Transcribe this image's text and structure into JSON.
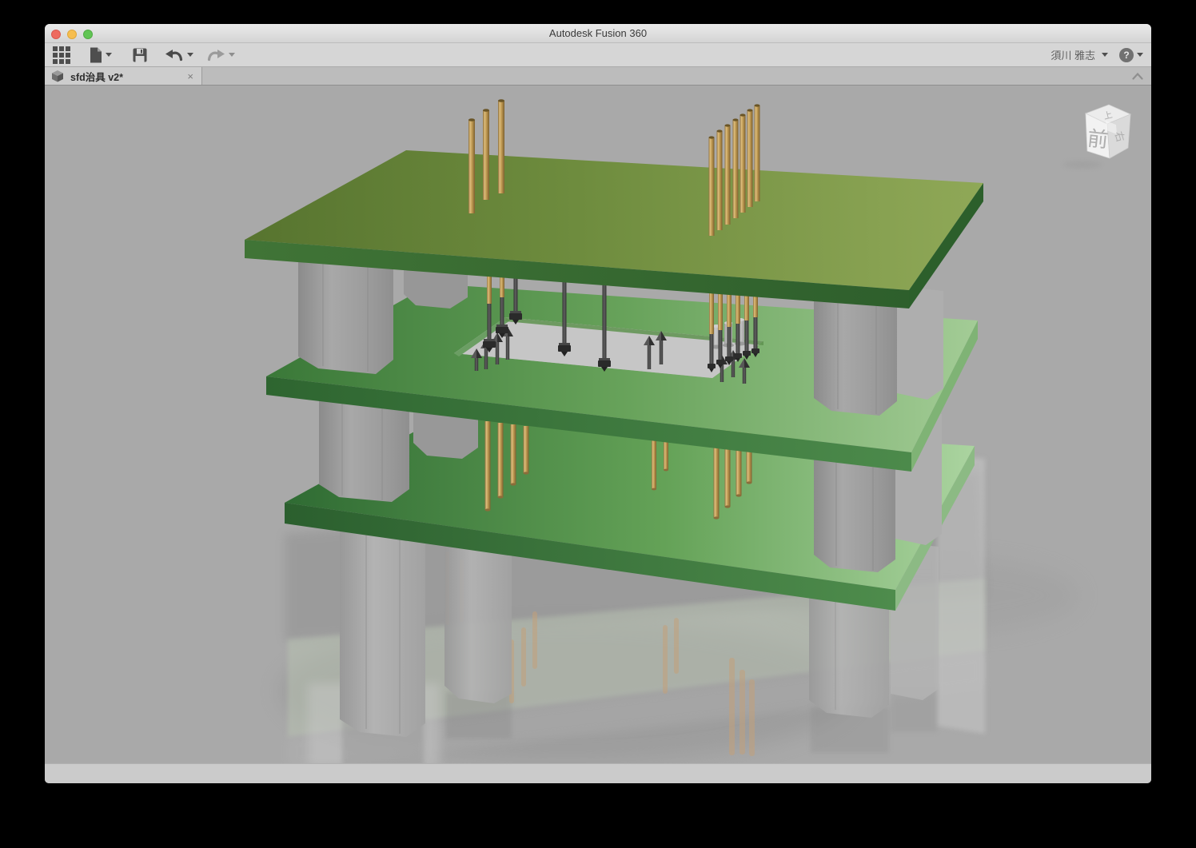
{
  "window": {
    "title": "Autodesk Fusion 360",
    "traffic_lights": [
      "close",
      "minimize",
      "zoom"
    ]
  },
  "toolbar": {
    "icons": [
      {
        "name": "app-launcher-grid"
      },
      {
        "name": "file-new",
        "has_dropdown": true
      },
      {
        "name": "save"
      },
      {
        "name": "undo",
        "has_dropdown": true
      },
      {
        "name": "redo",
        "has_dropdown": true,
        "disabled": true
      }
    ],
    "user_name": "須川 雅志",
    "help_glyph": "?"
  },
  "tab_bar": {
    "active_tab": {
      "label": "sfd治具 v2*",
      "close_glyph": "×",
      "modified": true
    },
    "collapse_icon": "chevron-up"
  },
  "viewcube": {
    "front_label": "前",
    "top_label": "上",
    "right_label": "右"
  },
  "viewport": {
    "background_color": "#a9a9a9",
    "bottom_strip_color": "#cbcbcb",
    "model": {
      "description": "3-tier green PCB test jig",
      "board_green": "#4a8242",
      "board_pale_green": "#a3cc96",
      "standoff_gray": "#9e9e9e",
      "brass_pin": "#c09a52",
      "probe_dark": "#3a3a3a"
    }
  }
}
